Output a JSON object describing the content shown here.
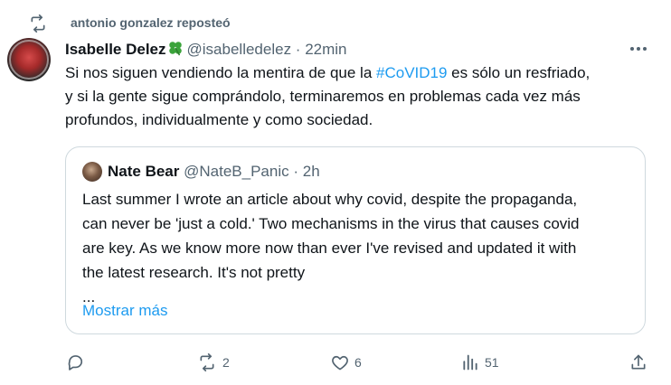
{
  "repost": {
    "text": "antonio gonzalez reposteó"
  },
  "tweet": {
    "author_name": "Isabelle Delez",
    "author_handle": "@isabelledelez",
    "separator": "·",
    "time": "22min",
    "text_lines": [
      {
        "before": "Si nos siguen vendiendo la mentira de que la ",
        "hashtag": "#CoVID19",
        "after": " es sólo un resfriado,"
      },
      {
        "before": "y si la gente sigue comprándolo, terminaremos en problemas cada vez más"
      },
      {
        "before": "profundos, individualmente y como sociedad."
      }
    ]
  },
  "quote": {
    "author_name": "Nate Bear",
    "author_handle": "@NateB_Panic",
    "separator": "·",
    "time": "2h",
    "text_lines": [
      "Last summer I wrote an article about why covid, despite the propaganda,",
      "can never be 'just a cold.' Two mechanisms in the virus that causes covid",
      "are key. As we know more now than ever I've revised and updated it with",
      "the latest research. It's not pretty",
      "..."
    ],
    "show_more": "Mostrar más"
  },
  "actions": {
    "reply_count": "",
    "repost_count": "2",
    "like_count": "6",
    "views_count": "51"
  },
  "icons": {
    "repost": "repost-icon",
    "clover": "four-leaf-clover-icon",
    "more": "more-options-icon",
    "reply": "reply-icon",
    "like": "heart-icon",
    "views": "views-icon",
    "share": "share-icon"
  },
  "colors": {
    "accent": "#1d9bf0",
    "muted": "#536471",
    "text": "#0f1419",
    "border": "#cfd9de",
    "clover": "#3ba33b"
  }
}
